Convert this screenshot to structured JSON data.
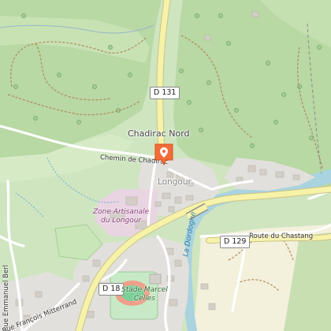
{
  "map": {
    "labels": {
      "chadirac_nord": "Chadirac Nord",
      "chemin_chadirac": "Chemin de Chadirac",
      "longour": "Longour",
      "zone_artisanale_1": "Zone Artisanale",
      "zone_artisanale_2": "du Longour",
      "la_dordogne": "La Dordogne",
      "route_chastang": "Route du Chastang",
      "rue_emmanuel": "Rue Emmanuel Berl",
      "rue_francois": "Rue François Mitterrand",
      "stade_1": "Stade Marcel",
      "stade_2": "Celles"
    },
    "shields": {
      "d131": "D 131",
      "d129": "D 129",
      "d18": "D 18"
    },
    "marker": {
      "icon": "location-pin-icon",
      "color": "#f26b3a"
    },
    "colors": {
      "forest": "#b5d6a2",
      "meadow": "#cfe5c0",
      "farmland": "#f3f0dc",
      "water": "#a9d3df",
      "road": "#f6f2a8",
      "residential": "#e2e0dc",
      "industrial": "#e9d4e2",
      "pitch": "#7dcf9a"
    }
  }
}
